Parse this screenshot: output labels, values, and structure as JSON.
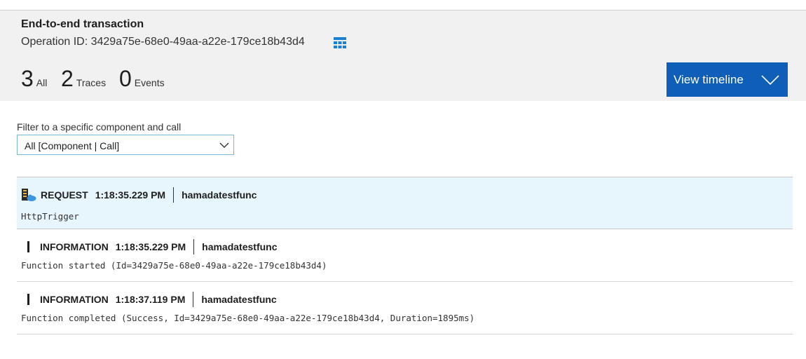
{
  "header": {
    "title": "End-to-end transaction",
    "operation_id_label": "Operation ID: 3429a75e-68e0-49aa-a22e-179ce18b43d4",
    "grid_icon": "grid-icon"
  },
  "counts": {
    "all": {
      "num": "3",
      "label": "All"
    },
    "traces": {
      "num": "2",
      "label": "Traces"
    },
    "events": {
      "num": "0",
      "label": "Events"
    }
  },
  "timeline_button": {
    "label": "View timeline",
    "icon": "chevron-down-icon"
  },
  "filter": {
    "label": "Filter to a specific component and call",
    "value": "All [Component | Call]"
  },
  "rows": [
    {
      "type": "REQUEST",
      "time": "1:18:35.229 PM",
      "component": "hamadatestfunc",
      "message": "HttpTrigger",
      "icon": "function-app-icon"
    },
    {
      "type": "INFORMATION",
      "time": "1:18:35.229 PM",
      "component": "hamadatestfunc",
      "message": "Function started (Id=3429a75e-68e0-49aa-a22e-179ce18b43d4)",
      "icon": "trace-icon"
    },
    {
      "type": "INFORMATION",
      "time": "1:18:37.119 PM",
      "component": "hamadatestfunc",
      "message": "Function completed (Success, Id=3429a75e-68e0-49aa-a22e-179ce18b43d4, Duration=1895ms)",
      "icon": "trace-icon"
    }
  ],
  "colors": {
    "accent": "#0f5fb8",
    "selected_row": "#e6f6fc",
    "header_bg": "#f1f1f1"
  }
}
